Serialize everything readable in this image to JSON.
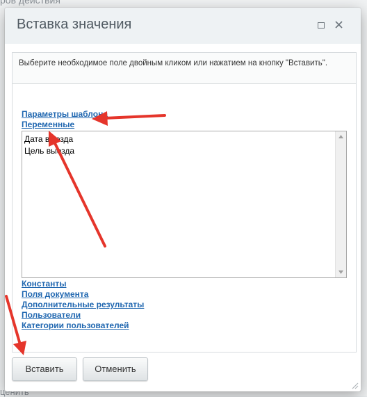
{
  "background": {
    "top_text": "ров действия",
    "bottom_text": "ценить"
  },
  "dialog": {
    "title": "Вставка значения",
    "maximize_icon": "maximize-icon",
    "close_icon": "close-icon",
    "hint": "Выберите необходимое поле двойным кликом или нажатием на кнопку \"Вставить\".",
    "groups_before": [
      "Параметры шаблона",
      "Переменные"
    ],
    "list_items": [
      "Дата выезда",
      "Цель выезда"
    ],
    "groups_after": [
      "Константы",
      "Поля документа",
      "Дополнительные результаты",
      "Пользователи",
      "Категории пользователей"
    ],
    "buttons": {
      "insert": "Вставить",
      "cancel": "Отменить"
    }
  },
  "colors": {
    "link": "#2067b0",
    "annotation_arrow": "#e5352b",
    "titlebar": "#eef2f4"
  }
}
